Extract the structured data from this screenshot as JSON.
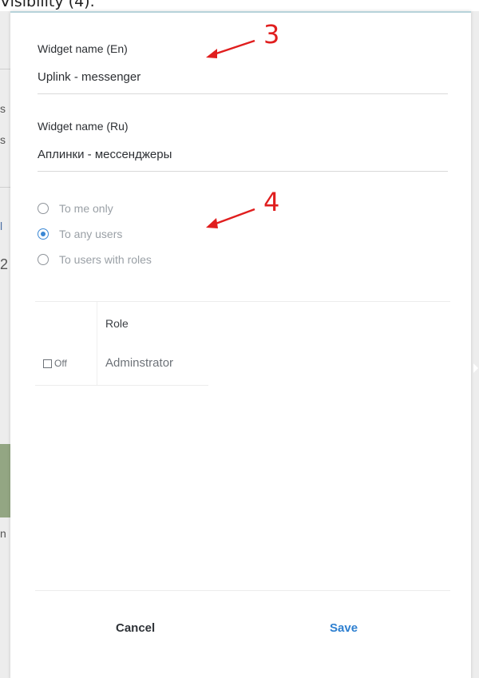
{
  "caption": "Visibility (4).",
  "background_fragments": [
    "s",
    "s",
    "l",
    "2",
    "n"
  ],
  "dialog": {
    "widget_name_en": {
      "label": "Widget name (En)",
      "value": "Uplink - messenger"
    },
    "widget_name_ru": {
      "label": "Widget name (Ru)",
      "value": "Аплинки - мессенджеры"
    },
    "visibility_options": [
      {
        "label": "To me only",
        "selected": false
      },
      {
        "label": "To any users",
        "selected": true
      },
      {
        "label": "To users with roles",
        "selected": false
      }
    ],
    "roles_table": {
      "header_role": "Role",
      "rows": [
        {
          "toggle": "Off",
          "role": "Adminstrator"
        }
      ]
    },
    "buttons": {
      "cancel": "Cancel",
      "save": "Save"
    }
  },
  "annotations": [
    {
      "number": "3"
    },
    {
      "number": "4"
    }
  ],
  "colors": {
    "accent_blue": "#3a87d4",
    "save_blue": "#2d7fd0",
    "annotation_red": "#e01e1e"
  }
}
